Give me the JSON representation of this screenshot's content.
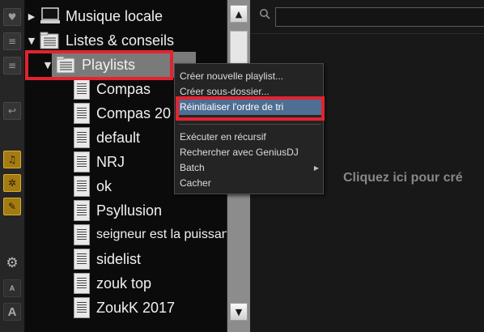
{
  "tree": {
    "items": [
      {
        "label": "Musique locale",
        "icon": "computer-icon",
        "expanded": false
      },
      {
        "label": "Listes & conseils",
        "icon": "folder-list-icon",
        "expanded": true
      },
      {
        "label": "Playlists",
        "icon": "folder-list-icon",
        "expanded": true,
        "selected": true
      },
      {
        "label": "Compas",
        "icon": "document-icon"
      },
      {
        "label": "Compas 20",
        "icon": "document-icon"
      },
      {
        "label": "default",
        "icon": "document-icon"
      },
      {
        "label": "NRJ",
        "icon": "document-icon"
      },
      {
        "label": "ok",
        "icon": "document-icon"
      },
      {
        "label": "Psyllusion",
        "icon": "document-icon"
      },
      {
        "label": "seigneur est la puissance",
        "icon": "document-icon"
      },
      {
        "label": "sidelist",
        "icon": "document-icon"
      },
      {
        "label": "zouk top",
        "icon": "document-icon"
      },
      {
        "label": "ZoukK 2017",
        "icon": "document-icon"
      }
    ]
  },
  "toolbar": {
    "buttons": [
      {
        "icon": "heart-add-icon"
      },
      {
        "icon": "list-add-icon"
      },
      {
        "icon": "list-info-icon"
      },
      {
        "icon": "back-icon"
      },
      {
        "icon": "music-note-icon"
      },
      {
        "icon": "video-reel-icon"
      },
      {
        "icon": "pencil-icon"
      },
      {
        "icon": "gear-icon"
      },
      {
        "icon": "font-small-icon",
        "label": "A"
      },
      {
        "icon": "font-large-icon",
        "label": "A"
      }
    ]
  },
  "context_menu": {
    "items": [
      {
        "label": "Créer nouvelle playlist..."
      },
      {
        "label": "Créer sous-dossier..."
      },
      {
        "label": "Réinitialiser l'ordre de tri",
        "active": true
      },
      {
        "label": "Exécuter en récursif"
      },
      {
        "label": "Rechercher avec GeniusDJ"
      },
      {
        "label": "Batch",
        "submenu": true
      },
      {
        "label": "Cacher"
      }
    ],
    "submenu_arrow": "▶"
  },
  "search": {
    "value": "",
    "placeholder": ""
  },
  "right_panel": {
    "message": "Cliquez ici pour cré"
  },
  "scrollbar": {
    "up": "▲",
    "down": "▼"
  },
  "colors": {
    "highlight_box": "#e3232f",
    "menu_active": "#4e6e93",
    "selected_row": "#7a7a7a"
  }
}
